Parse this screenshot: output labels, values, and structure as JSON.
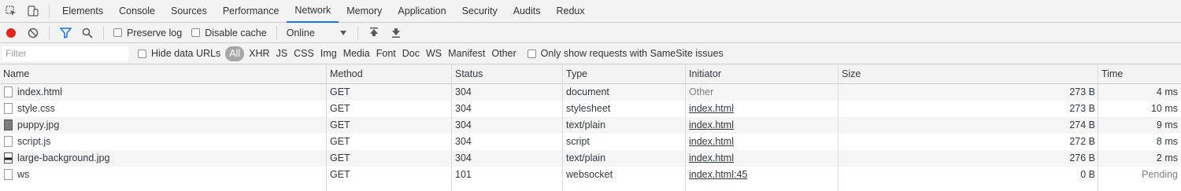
{
  "tabs": [
    {
      "label": "Elements",
      "active": false
    },
    {
      "label": "Console",
      "active": false
    },
    {
      "label": "Sources",
      "active": false
    },
    {
      "label": "Performance",
      "active": false
    },
    {
      "label": "Network",
      "active": true
    },
    {
      "label": "Memory",
      "active": false
    },
    {
      "label": "Application",
      "active": false
    },
    {
      "label": "Security",
      "active": false
    },
    {
      "label": "Audits",
      "active": false
    },
    {
      "label": "Redux",
      "active": false
    }
  ],
  "toolbar": {
    "preserve_log_label": "Preserve log",
    "disable_cache_label": "Disable cache",
    "throttling_value": "Online"
  },
  "filter": {
    "placeholder": "Filter",
    "hide_data_urls_label": "Hide data URLs",
    "types": [
      "All",
      "XHR",
      "JS",
      "CSS",
      "Img",
      "Media",
      "Font",
      "Doc",
      "WS",
      "Manifest",
      "Other"
    ],
    "samesite_label": "Only show requests with SameSite issues"
  },
  "columns": [
    "Name",
    "Method",
    "Status",
    "Type",
    "Initiator",
    "Size",
    "Time"
  ],
  "rows": [
    {
      "name": "index.html",
      "method": "GET",
      "status": "304",
      "type": "document",
      "initiator": "Other",
      "size": "273 B",
      "time": "4 ms",
      "icon": "file-icon"
    },
    {
      "name": "style.css",
      "method": "GET",
      "status": "304",
      "type": "stylesheet",
      "initiator": "index.html",
      "size": "273 B",
      "time": "10 ms",
      "icon": "file-icon"
    },
    {
      "name": "puppy.jpg",
      "method": "GET",
      "status": "304",
      "type": "text/plain",
      "initiator": "index.html",
      "size": "274 B",
      "time": "9 ms",
      "icon": "image-icon"
    },
    {
      "name": "script.js",
      "method": "GET",
      "status": "304",
      "type": "script",
      "initiator": "index.html",
      "size": "272 B",
      "time": "8 ms",
      "icon": "file-icon"
    },
    {
      "name": "large-background.jpg",
      "method": "GET",
      "status": "304",
      "type": "text/plain",
      "initiator": "index.html",
      "size": "276 B",
      "time": "2 ms",
      "icon": "image-icon"
    },
    {
      "name": "ws",
      "method": "GET",
      "status": "101",
      "type": "websocket",
      "initiator": "index.html:45",
      "size": "0 B",
      "time": "Pending",
      "icon": "file-icon"
    }
  ],
  "colors": {
    "record": "#e0271e",
    "accent": "#1a73e8",
    "filter_active": "#1a73e8"
  }
}
